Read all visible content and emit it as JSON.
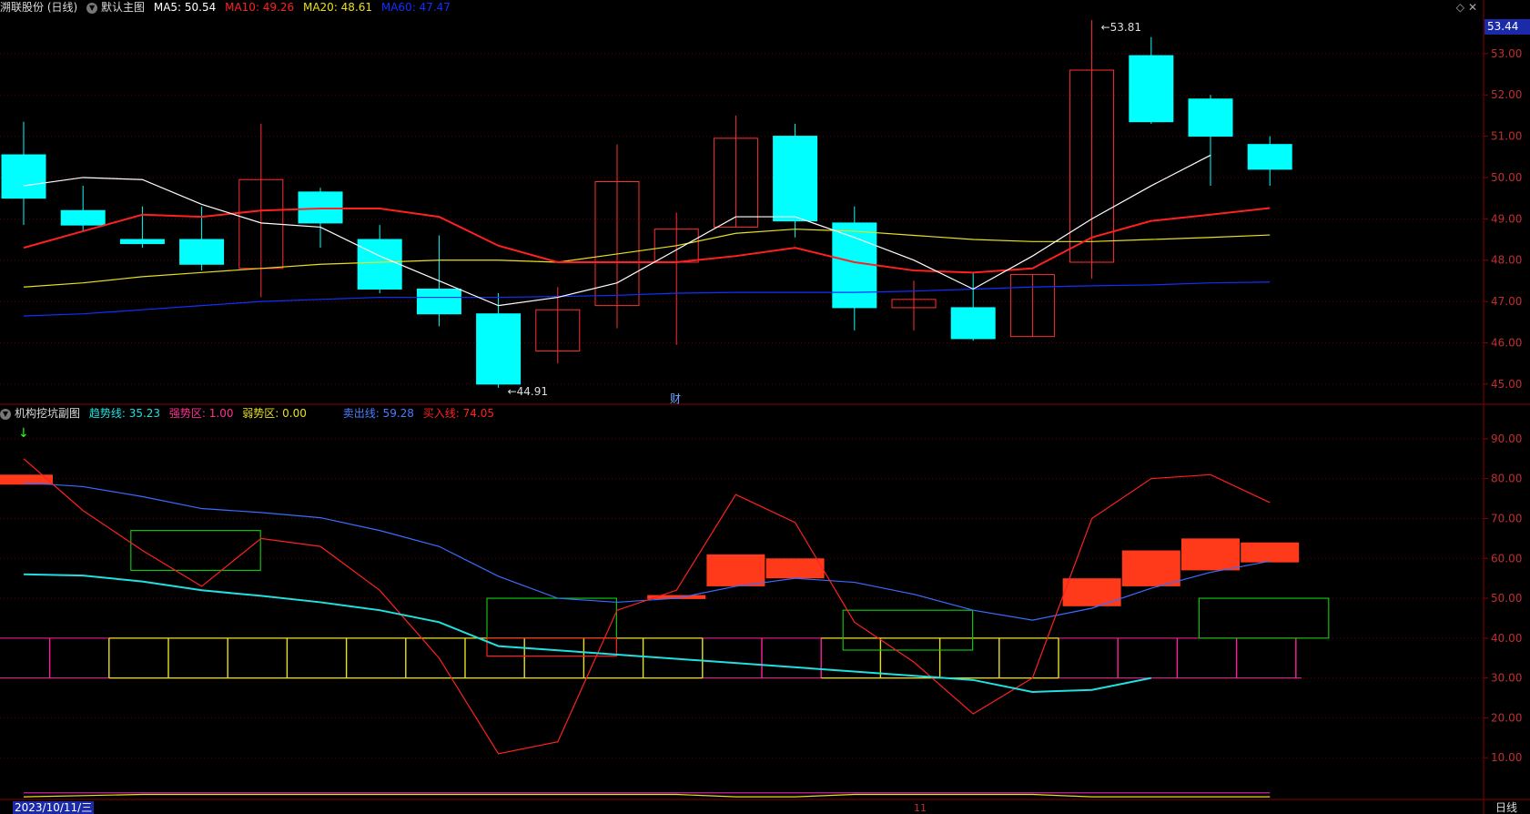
{
  "top_header": {
    "stock": "溯联股份 (日线)",
    "panel": "默认主图",
    "ma5": "MA5: 50.54",
    "ma10": "MA10: 49.26",
    "ma20": "MA20: 48.61",
    "ma60": "MA60: 47.47"
  },
  "sub_header": {
    "panel": "机构挖坑副图",
    "trend": "趋势线: 35.23",
    "strong": "强势区: 1.00",
    "weak": "弱势区: 0.00",
    "sell": "卖出线: 59.28",
    "buy": "买入线: 74.05"
  },
  "last_price": "53.44",
  "date_label": "2023/10/11/三",
  "period_label": "日线",
  "x_tick_label": "11",
  "finance_mark": "财",
  "colors": {
    "up": "#ff3030",
    "down": "#00ffff",
    "ma5": "#ffffff",
    "ma10": "#ff2020",
    "ma20": "#e8e020",
    "ma60": "#1030ff",
    "grid": "#5a0000",
    "axis_text": "#c03030"
  },
  "chart_data": [
    {
      "type": "candlestick",
      "title": "默认主图",
      "ylim": [
        44.6,
        53.9
      ],
      "y_ticks": [
        "45.00",
        "46.00",
        "47.00",
        "48.00",
        "49.00",
        "50.00",
        "51.00",
        "52.00",
        "53.00"
      ],
      "candles": [
        {
          "o": 50.55,
          "h": 51.35,
          "l": 48.85,
          "c": 49.5
        },
        {
          "o": 49.2,
          "h": 49.8,
          "l": 48.7,
          "c": 48.85
        },
        {
          "o": 48.5,
          "h": 49.3,
          "l": 48.3,
          "c": 48.4
        },
        {
          "o": 48.5,
          "h": 49.3,
          "l": 47.75,
          "c": 47.9
        },
        {
          "o": 47.8,
          "h": 51.3,
          "l": 47.1,
          "c": 49.95
        },
        {
          "o": 49.65,
          "h": 49.75,
          "l": 48.3,
          "c": 48.9
        },
        {
          "o": 48.5,
          "h": 48.85,
          "l": 47.2,
          "c": 47.3
        },
        {
          "o": 47.3,
          "h": 48.6,
          "l": 46.4,
          "c": 46.7
        },
        {
          "o": 46.7,
          "h": 47.2,
          "l": 44.91,
          "c": 45.0
        },
        {
          "o": 45.8,
          "h": 47.35,
          "l": 45.5,
          "c": 46.8
        },
        {
          "o": 46.9,
          "h": 50.8,
          "l": 46.35,
          "c": 49.9
        },
        {
          "o": 47.95,
          "h": 49.15,
          "l": 45.95,
          "c": 48.75
        },
        {
          "o": 48.8,
          "h": 51.5,
          "l": 48.8,
          "c": 50.95
        },
        {
          "o": 51.0,
          "h": 51.3,
          "l": 48.55,
          "c": 48.95
        },
        {
          "o": 48.9,
          "h": 49.3,
          "l": 46.3,
          "c": 46.85
        },
        {
          "o": 46.85,
          "h": 47.5,
          "l": 46.3,
          "c": 47.05
        },
        {
          "o": 46.85,
          "h": 47.7,
          "l": 46.05,
          "c": 46.1
        },
        {
          "o": 46.15,
          "h": 47.65,
          "l": 46.15,
          "c": 47.65
        },
        {
          "o": 47.95,
          "h": 53.81,
          "l": 47.55,
          "c": 52.6
        },
        {
          "o": 52.95,
          "h": 53.4,
          "l": 51.3,
          "c": 51.35
        },
        {
          "o": 51.9,
          "h": 52.0,
          "l": 49.8,
          "c": 51.0
        },
        {
          "o": 50.8,
          "h": 51.0,
          "l": 49.8,
          "c": 50.2
        }
      ],
      "ma5": [
        49.8,
        50.0,
        49.95,
        49.35,
        48.9,
        48.8,
        48.1,
        47.5,
        46.9,
        47.1,
        47.45,
        48.25,
        49.05,
        49.05,
        48.55,
        48.0,
        47.3,
        48.1,
        49.0,
        49.8,
        50.54
      ],
      "ma10": [
        48.3,
        48.7,
        49.1,
        49.05,
        49.2,
        49.25,
        49.25,
        49.05,
        48.35,
        47.95,
        47.95,
        47.95,
        48.1,
        48.3,
        47.95,
        47.75,
        47.7,
        47.8,
        48.55,
        48.95,
        49.1,
        49.26
      ],
      "ma20": [
        47.35,
        47.45,
        47.6,
        47.7,
        47.8,
        47.9,
        47.95,
        48.0,
        48.0,
        47.95,
        48.15,
        48.35,
        48.65,
        48.75,
        48.7,
        48.6,
        48.5,
        48.45,
        48.45,
        48.5,
        48.55,
        48.61
      ],
      "ma60": [
        46.65,
        46.7,
        46.8,
        46.9,
        47.0,
        47.05,
        47.1,
        47.1,
        47.1,
        47.12,
        47.15,
        47.2,
        47.22,
        47.22,
        47.22,
        47.25,
        47.3,
        47.35,
        47.38,
        47.4,
        47.45,
        47.47
      ],
      "annotations": [
        {
          "i": 18,
          "value": 53.81,
          "label": "53.81"
        },
        {
          "i": 8,
          "value": 44.91,
          "label": "44.91"
        }
      ]
    },
    {
      "type": "indicator",
      "title": "机构挖坑副图",
      "ylim": [
        0,
        95
      ],
      "y_ticks": [
        "10.00",
        "20.00",
        "30.00",
        "40.00",
        "50.00",
        "60.00",
        "70.00",
        "80.00",
        "90.00"
      ],
      "buy_line": [
        85,
        72,
        62,
        53,
        65,
        63,
        52,
        35,
        11,
        14,
        47,
        52,
        76,
        69,
        44,
        34,
        21,
        30,
        70,
        80,
        81,
        74
      ],
      "sell_line": [
        79,
        78,
        75.5,
        72.5,
        71.5,
        70.2,
        67,
        63,
        55.5,
        50,
        49,
        50,
        53,
        55,
        54,
        51,
        47,
        44.5,
        47.5,
        52.5,
        56.5,
        59.3
      ],
      "trend_line": [
        56,
        55.7,
        54.2,
        52,
        50.6,
        49,
        47,
        44,
        38,
        null,
        null,
        null,
        null,
        null,
        null,
        null,
        29.5,
        26.5,
        27,
        30
      ],
      "trend_line_start": 0,
      "zone_low": [
        null,
        30,
        30,
        30,
        30,
        30,
        30,
        30,
        30,
        30,
        30,
        30,
        null,
        null,
        30,
        30,
        30,
        30,
        null,
        null,
        null,
        null
      ],
      "red_bars": [
        {
          "i": 0,
          "low": 78.5,
          "high": 81
        },
        {
          "i": 11,
          "low": 49.8,
          "high": 50.8
        },
        {
          "i": 12,
          "low": 53,
          "high": 61
        },
        {
          "i": 13,
          "low": 55,
          "high": 60
        },
        {
          "i": 18,
          "low": 48,
          "high": 55
        },
        {
          "i": 19,
          "low": 53,
          "high": 62
        },
        {
          "i": 20,
          "low": 57,
          "high": 65
        },
        {
          "i": 21,
          "low": 59,
          "high": 64
        }
      ],
      "green_boxes": [
        {
          "i0": 2,
          "i1": 4,
          "low": 57,
          "high": 67
        },
        {
          "i0": 8,
          "i1": 10,
          "low": 40,
          "high": 50
        },
        {
          "i0": 14,
          "i1": 16,
          "low": 37,
          "high": 47
        },
        {
          "i0": 20,
          "i1": 22,
          "low": 40,
          "high": 50
        }
      ],
      "red_boxes": [
        {
          "i0": 8,
          "i1": 10,
          "low": 35.5,
          "high": 40
        }
      ],
      "strong_zone": "1.00",
      "weak_zone": "0.00"
    }
  ]
}
